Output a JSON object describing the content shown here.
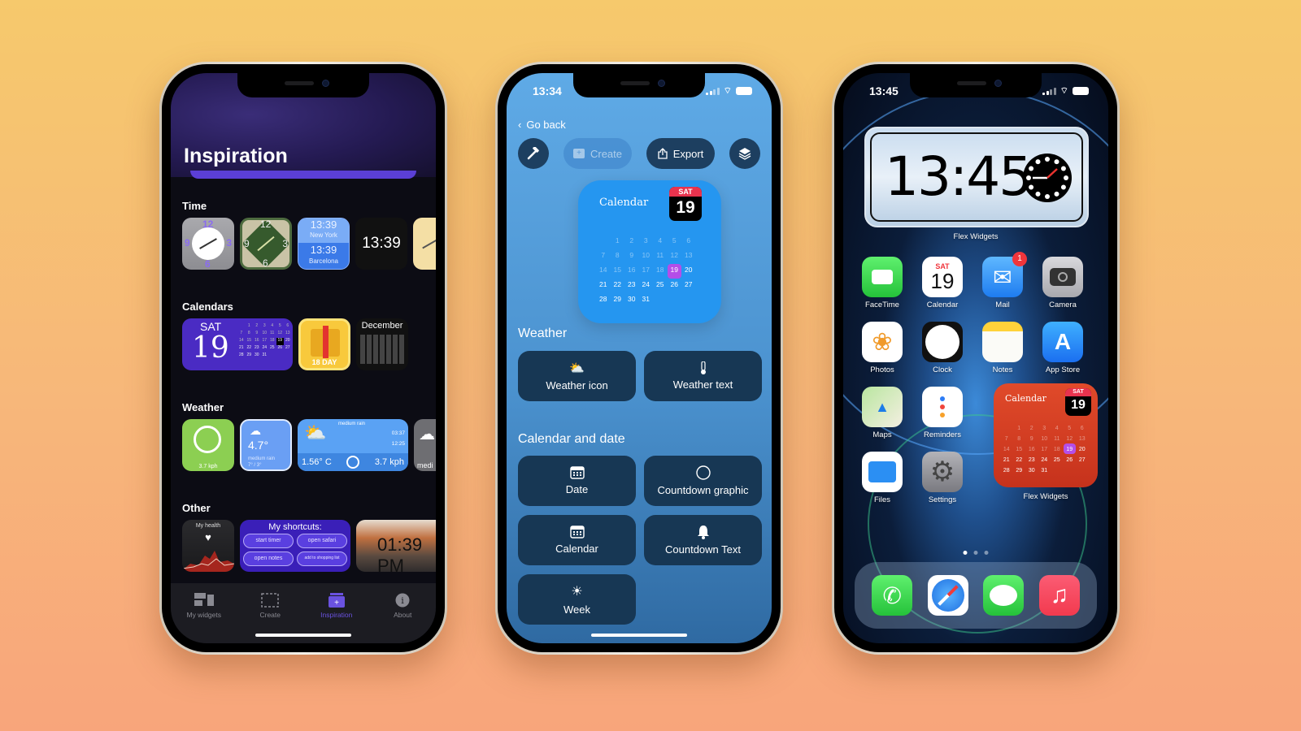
{
  "phone1": {
    "title": "Inspiration",
    "sections": [
      {
        "label": "Time"
      },
      {
        "label": "Calendars"
      },
      {
        "label": "Weather"
      },
      {
        "label": "Other"
      }
    ],
    "time_widgets": {
      "analog_numbers": [
        "12",
        "3",
        "6",
        "9"
      ],
      "world_clock": [
        {
          "time": "13:39",
          "city": "New York"
        },
        {
          "time": "13:39",
          "city": "Barcelona"
        }
      ],
      "digital": "13:39"
    },
    "calendar_widgets": {
      "day_name": "SAT",
      "day_number": "19",
      "gift_label": "18 DAY",
      "month": "December"
    },
    "weather_widgets": {
      "wind1": "3.7 kph",
      "temp": "4.7°",
      "cond": "medium rain",
      "range": "7° / 3°",
      "wide_cond": "medium rain",
      "sunrise": "03:37",
      "sunset": "12:25",
      "wide_temp": "1.56° C",
      "wide_wind": "3.7",
      "wide_wind_unit": "kph",
      "partial": "medi"
    },
    "other_widgets": {
      "health_title": "My health",
      "shortcuts_title": "My shortcuts:",
      "shortcuts": [
        "start timer",
        "open safari",
        "open notes",
        "add to shopping list"
      ],
      "photo_time": "01:39 PM"
    },
    "tabs": [
      {
        "label": "My widgets",
        "icon": "widgets-icon",
        "active": false
      },
      {
        "label": "Create",
        "icon": "create-icon",
        "active": false
      },
      {
        "label": "Inspiration",
        "icon": "inspiration-icon",
        "active": true
      },
      {
        "label": "About",
        "icon": "info-icon",
        "active": false
      }
    ]
  },
  "phone2": {
    "status_time": "13:34",
    "go_back": "Go back",
    "toolbar": {
      "create": "Create",
      "export": "Export"
    },
    "calendar_widget": {
      "title": "Calendar",
      "day_name": "SAT",
      "day_number": "19",
      "leading_blanks": 1,
      "days_in_month": 31,
      "today": 19
    },
    "sections": [
      {
        "label": "Weather",
        "tiles": [
          {
            "label": "Weather icon",
            "icon": "weather-cloud-sun-icon"
          },
          {
            "label": "Weather text",
            "icon": "thermometer-icon"
          }
        ]
      },
      {
        "label": "Calendar and date",
        "tiles": [
          {
            "label": "Date",
            "icon": "calendar-icon"
          },
          {
            "label": "Countdown graphic",
            "icon": "circle-icon"
          },
          {
            "label": "Calendar",
            "icon": "calendar-icon"
          },
          {
            "label": "Countdown Text",
            "icon": "bell-icon"
          },
          {
            "label": "Week",
            "icon": "sun-icon"
          }
        ]
      }
    ]
  },
  "phone3": {
    "status_time": "13:45",
    "clock_widget": {
      "time": "13:45",
      "label": "Flex Widgets"
    },
    "apps": [
      {
        "label": "FaceTime",
        "icon": "facetime-icon"
      },
      {
        "label": "Calendar",
        "icon": "calendar-app-icon",
        "day_name": "SAT",
        "day_number": "19"
      },
      {
        "label": "Mail",
        "icon": "mail-icon",
        "badge": "1"
      },
      {
        "label": "Camera",
        "icon": "camera-icon"
      },
      {
        "label": "Photos",
        "icon": "photos-icon"
      },
      {
        "label": "Clock",
        "icon": "clock-icon"
      },
      {
        "label": "Notes",
        "icon": "notes-icon"
      },
      {
        "label": "App Store",
        "icon": "app-store-icon"
      },
      {
        "label": "Maps",
        "icon": "maps-icon"
      },
      {
        "label": "Reminders",
        "icon": "reminders-icon"
      },
      {
        "label": "Files",
        "icon": "files-icon"
      },
      {
        "label": "Settings",
        "icon": "settings-icon"
      }
    ],
    "calendar_widget": {
      "title": "Calendar",
      "day_name": "SAT",
      "day_number": "19",
      "label": "Flex Widgets",
      "leading_blanks": 1,
      "days_in_month": 31,
      "today": 19
    },
    "page_dots": {
      "count": 3,
      "active": 0
    },
    "dock": [
      {
        "label": "Phone",
        "icon": "phone-icon"
      },
      {
        "label": "Safari",
        "icon": "safari-icon"
      },
      {
        "label": "Messages",
        "icon": "messages-icon"
      },
      {
        "label": "Music",
        "icon": "music-icon"
      }
    ]
  },
  "colors": {
    "accent_purple": "#5b3fd6",
    "p2_tile": "#173754",
    "calendar_today": "#b44ee8",
    "red_badge": "#f0353b"
  }
}
